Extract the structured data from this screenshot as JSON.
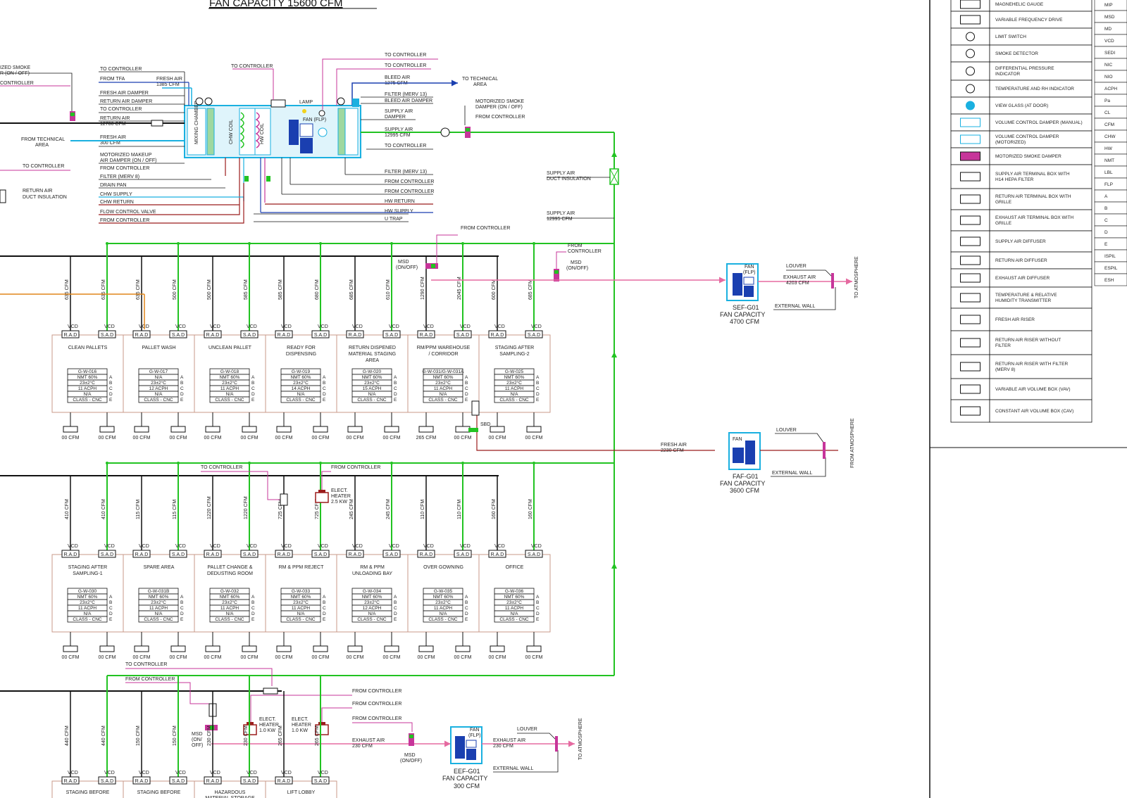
{
  "title": "FAN CAPACITY 15600 CFM",
  "ahu": {
    "left_labels": [
      "TO CONTROLLER",
      "FROM TFA",
      "FRESH AIR DAMPER",
      "RETURN AIR DAMPER",
      "TO CONTROLLER",
      "RETURN AIR",
      "12780 CFM",
      "FRESH AIR",
      "300 CFM",
      "MOTORIZED MAKEUP",
      "AIR DAMPER (ON / OFF)",
      "FROM CONTROLLER",
      "FILTER (MERV 8)",
      "DRAIN PAN",
      "CHW SUPPLY",
      "CHW RETURN",
      "FLOW CONTROL VALVE",
      "FROM CONTROLLER"
    ],
    "fresh_air_top": [
      "FRESH AIR",
      "1385 CFM"
    ],
    "from_tech_area": [
      "FROM TECHNICAL",
      "AREA"
    ],
    "to_controller_top": "TO CONTROLLER",
    "right_labels": [
      "TO CONTROLLER",
      "TO CONTROLLER",
      "BLEED AIR",
      "1275 CFM",
      "FILTER (MERV 13)",
      "BLEED AIR DAMPER",
      "SUPPLY AIR",
      "DAMPER",
      "SUPPLY AIR",
      "12995 CFM",
      "TO CONTROLLER"
    ],
    "bottom_right_labels": [
      "FILTER (MERV 13)",
      "FROM CONTROLLER",
      "FROM CONTROLLER",
      "HW RETURN",
      "HW SUPPLY",
      "U TRAP"
    ],
    "to_tech_area": [
      "TO TECHNICAL",
      "AREA"
    ],
    "lamp": "LAMP",
    "fan": "FAN (FLP)",
    "mixing": "MIXING CHAMBER",
    "chw_coil": "CHW COIL",
    "hw_coil": "HW COIL",
    "mot_smoke": [
      "MOTORIZED SMOKE",
      "DAMPER (ON / OFF)"
    ],
    "from_controller_r": "FROM CONTROLLER",
    "supply_duct_ins": [
      "SUPPLY AIR",
      "DUCT INSULATION"
    ],
    "supply_air_main": [
      "SUPPLY AIR",
      "12995 CFM"
    ],
    "left_edge": [
      "IZED SMOKE",
      "R (ON / OFF)",
      "CONTROLLER",
      "TO CONTROLLER",
      "RETURN AIR",
      "DUCT INSULATION"
    ]
  },
  "row1": {
    "controls": {
      "from_controller": "FROM CONTROLLER",
      "msd": [
        "MSD",
        "(ON/OFF)"
      ],
      "from_controller2": [
        "FROM",
        "CONTROLLER"
      ],
      "msd2": [
        "MSD",
        "(ON/OFF)"
      ]
    },
    "cfm_labels": [
      "635 CFM",
      "635 CFM",
      "635 CFM",
      "500 CFM",
      "500 CFM",
      "585 CFM",
      "585 CFM",
      "680 CFM",
      "685 CFM",
      "610 CFM",
      "1290 CFM",
      "2045 CFM",
      "600 CFM",
      "685 CFM"
    ],
    "rooms": [
      {
        "name": [
          "CLEAN PALLETS"
        ],
        "code": "G-W-016",
        "nmt": "NMT 60%",
        "temp": "23±2°C",
        "ach": "11 ACPH",
        "na": "N/A",
        "cls": "CLASS - CNC",
        "cfm": [
          "00 CFM",
          "00 CFM"
        ]
      },
      {
        "name": [
          "PALLET WASH"
        ],
        "code": "G-W-017",
        "nmt": "N/A",
        "temp": "23±2°C",
        "ach": "12 ACPH",
        "na": "N/A",
        "cls": "CLASS - CNC",
        "cfm": [
          "00 CFM",
          "00 CFM"
        ]
      },
      {
        "name": [
          "UNCLEAN PALLET"
        ],
        "code": "G-W-018",
        "nmt": "NMT 60%",
        "temp": "23±2°C",
        "ach": "11 ACPH",
        "na": "N/A",
        "cls": "CLASS - CNC",
        "cfm": [
          "00 CFM",
          "00 CFM"
        ]
      },
      {
        "name": [
          "READY FOR",
          "DISPENSING"
        ],
        "code": "G-W-019",
        "nmt": "NMT 60%",
        "temp": "23±2°C",
        "ach": "14 ACPH",
        "na": "N/A",
        "cls": "CLASS - CNC",
        "cfm": [
          "00 CFM",
          "00 CFM"
        ]
      },
      {
        "name": [
          "RETURN DISPENED",
          "MATERIAL STAGING",
          "AREA"
        ],
        "code": "G-W-020",
        "nmt": "NMT 60%",
        "temp": "23±2°C",
        "ach": "15 ACPH",
        "na": "N/A",
        "cls": "CLASS - CNC",
        "cfm": [
          "00 CFM",
          "00 CFM"
        ]
      },
      {
        "name": [
          "RM/PPM WAREHOUSE",
          "/ CORRIDOR"
        ],
        "code": "G-W-031/G-W-031A",
        "nmt": "NMT 60%",
        "temp": "23±2°C",
        "ach": "11 ACPH",
        "na": "N/A",
        "cls": "CLASS - CNC",
        "cfm": [
          "265 CFM",
          "00 CFM"
        ]
      },
      {
        "name": [
          "STAGING AFTER",
          "SAMPLING-2"
        ],
        "code": "G-W-025",
        "nmt": "NMT 60%",
        "temp": "23±2°C",
        "ach": "11 ACPH",
        "na": "N/A",
        "cls": "CLASS - CNC",
        "cfm": [
          "00 CFM",
          "00 CFM"
        ]
      }
    ]
  },
  "row2": {
    "controls": {
      "to_controller": "TO CONTROLLER",
      "from_controller": "FROM CONTROLLER",
      "heater": [
        "ELECT.",
        "HEATER",
        "2.5 KW"
      ]
    },
    "cfm_labels": [
      "410 CFM",
      "410 CFM",
      "115 CFM",
      "115 CFM",
      "1220 CFM",
      "1220 CFM",
      "725 CFM",
      "725 CFM",
      "245 CFM",
      "245 CFM",
      "110 CFM",
      "110 CFM",
      "160 CFM",
      "160 CFM"
    ],
    "rooms": [
      {
        "name": [
          "STAGING AFTER",
          "SAMPLING-1"
        ],
        "code": "G-W-030",
        "nmt": "NMT 60%",
        "temp": "23±2°C",
        "ach": "11 ACPH",
        "na": "N/A",
        "cls": "CLASS - CNC",
        "cfm": [
          "00 CFM",
          "00 CFM"
        ]
      },
      {
        "name": [
          "SPARE AREA"
        ],
        "code": "G-W-031B",
        "nmt": "NMT 60%",
        "temp": "23±2°C",
        "ach": "11 ACPH",
        "na": "N/A",
        "cls": "CLASS - CNC",
        "cfm": [
          "00 CFM",
          "00 CFM"
        ]
      },
      {
        "name": [
          "PALLET CHANGE &",
          "DEDUSTING ROOM"
        ],
        "code": "G-W-032",
        "nmt": "NMT 60%",
        "temp": "23±2°C",
        "ach": "11 ACPH",
        "na": "N/A",
        "cls": "CLASS - CNC",
        "cfm": [
          "00 CFM",
          "00 CFM"
        ]
      },
      {
        "name": [
          "RM & PPM REJECT"
        ],
        "code": "G-W-033",
        "nmt": "NMT 60%",
        "temp": "23±2°C",
        "ach": "11 ACPH",
        "na": "N/A",
        "cls": "CLASS - CNC",
        "cfm": [
          "00 CFM",
          "00 CFM"
        ]
      },
      {
        "name": [
          "RM & PPM",
          "UNLOADING BAY"
        ],
        "code": "G-W-034",
        "nmt": "NMT 60%",
        "temp": "23±2°C",
        "ach": "12 ACPH",
        "na": "N/A",
        "cls": "CLASS - CNC",
        "cfm": [
          "00 CFM",
          "00 CFM"
        ]
      },
      {
        "name": [
          "OVER GOWNING"
        ],
        "code": "G-W-035",
        "nmt": "NMT 60%",
        "temp": "23±2°C",
        "ach": "11 ACPH",
        "na": "N/A",
        "cls": "CLASS - CNC",
        "cfm": [
          "00 CFM",
          "00 CFM"
        ]
      },
      {
        "name": [
          "OFFICE"
        ],
        "code": "G-W-036",
        "nmt": "NMT 60%",
        "temp": "23±2°C",
        "ach": "11 ACPH",
        "na": "N/A",
        "cls": "CLASS - CNC",
        "cfm": [
          "00 CFM",
          "00 CFM"
        ]
      }
    ]
  },
  "row3": {
    "to_controller": "TO CONTROLLER",
    "from_controller": "FROM CONTROLLER",
    "cfm_labels": [
      "440 CFM",
      "440 CFM",
      "150 CFM",
      "150 CFM",
      "230 CFM",
      "230 CFM",
      "265 CFM",
      "265 CFM"
    ],
    "msd": [
      "MSD",
      "(ON/",
      "OFF)"
    ],
    "heater1": [
      "ELECT.",
      "HEATER",
      "1.0 KW"
    ],
    "heater2": [
      "ELECT.",
      "HEATER",
      "1.0 KW"
    ],
    "fc": [
      "FROM CONTROLLER",
      "FROM CONTROLLER",
      "FROM CONTROLLER"
    ],
    "exhaust": [
      "EXHAUST AIR",
      "230 CFM"
    ],
    "msd2": [
      "MSD",
      "(ON/OFF)"
    ],
    "rooms": [
      [
        "STAGING BEFORE"
      ],
      [
        "STAGING BEFORE"
      ],
      [
        "HAZARDOUS",
        "MATERIAL STORAGE"
      ],
      [
        "LIFT LOBBY"
      ]
    ]
  },
  "fans": {
    "sef": {
      "tag": "SEF-G01",
      "cap": "FAN CAPACITY",
      "cfm": "4700 CFM",
      "louver": "LOUVER",
      "exhaust": [
        "EXHAUST AIR",
        "4203 CFM"
      ],
      "ext_wall": "EXTERNAL WALL",
      "to_atm": "TO ATMOSPHERE",
      "fan": [
        "FAN",
        "(FLP)"
      ]
    },
    "faf": {
      "tag": "FAF-G01",
      "cap": "FAN CAPACITY",
      "cfm": "3600 CFM",
      "louver": "LOUVER",
      "fresh": [
        "FRESH AIR",
        "2230 CFM"
      ],
      "ext_wall": "EXTERNAL WALL",
      "from_atm": "FROM ATMOSPHERE",
      "fan": "FAN",
      "sbd": "SBD"
    },
    "eef": {
      "tag": "EEF-G01",
      "cap": "FAN CAPACITY",
      "cfm": "300 CFM",
      "louver": "LOUVER",
      "exhaust": [
        "EXHAUST AIR",
        "230 CFM"
      ],
      "ext_wall": "EXTERNAL WALL",
      "to_atm": "TO ATMOSPHERE",
      "fan": [
        "FAN",
        "(FLP)"
      ]
    }
  },
  "legend": {
    "items": [
      "MAGNEHELIC GAUGE",
      "VARIABLE FREQUENCY DRIVE",
      "LIMIT SWITCH",
      "SMOKE DETECTOR",
      "DIFFERENTIAL PRESSURE INDICATOR",
      "TEMPERATURE AND RH INDICATOR",
      "VIEW GLASS (AT DOOR)",
      "VOLUME CONTROL DAMPER (MANUAL)",
      "VOLUME CONTROL DAMPER (MOTORIZED)",
      "MOTORIZED SMOKE DAMPER",
      "SUPPLY AIR TERMINAL BOX WITH H14 HEPA FILTER",
      "RETURN AIR TERMINAL BOX WITH GRILLE",
      "EXHAUST AIR TERMINAL BOX WITH GRILLE",
      "SUPPLY AIR DIFFUSER",
      "RETURN AIR DIFFUSER",
      "EXHAUST AIR DIFFUSER",
      "TEMPERATURE & RELATIVE HUMIDITY TRANSMITTER",
      "FRESH AIR RISER",
      "RETURN AIR RISER WITHOUT FILTER",
      "RETURN AIR RISER WITH FILTER (MERV 8)",
      "VARIABLE AIR VOLUME BOX (VAV)",
      "CONSTANT AIR VOLUME BOX (CAV)"
    ],
    "abbr": [
      "MIP",
      "MSD",
      "MD",
      "VCD",
      "SEDI",
      "NIC",
      "NIO",
      "ACPH",
      "Pa",
      "CL",
      "CFM",
      "CHW",
      "HW",
      "NMT",
      "LBL",
      "FLP",
      "A",
      "B",
      "C",
      "D",
      "E",
      "ISPIL",
      "ESPIL",
      "ESH"
    ]
  }
}
